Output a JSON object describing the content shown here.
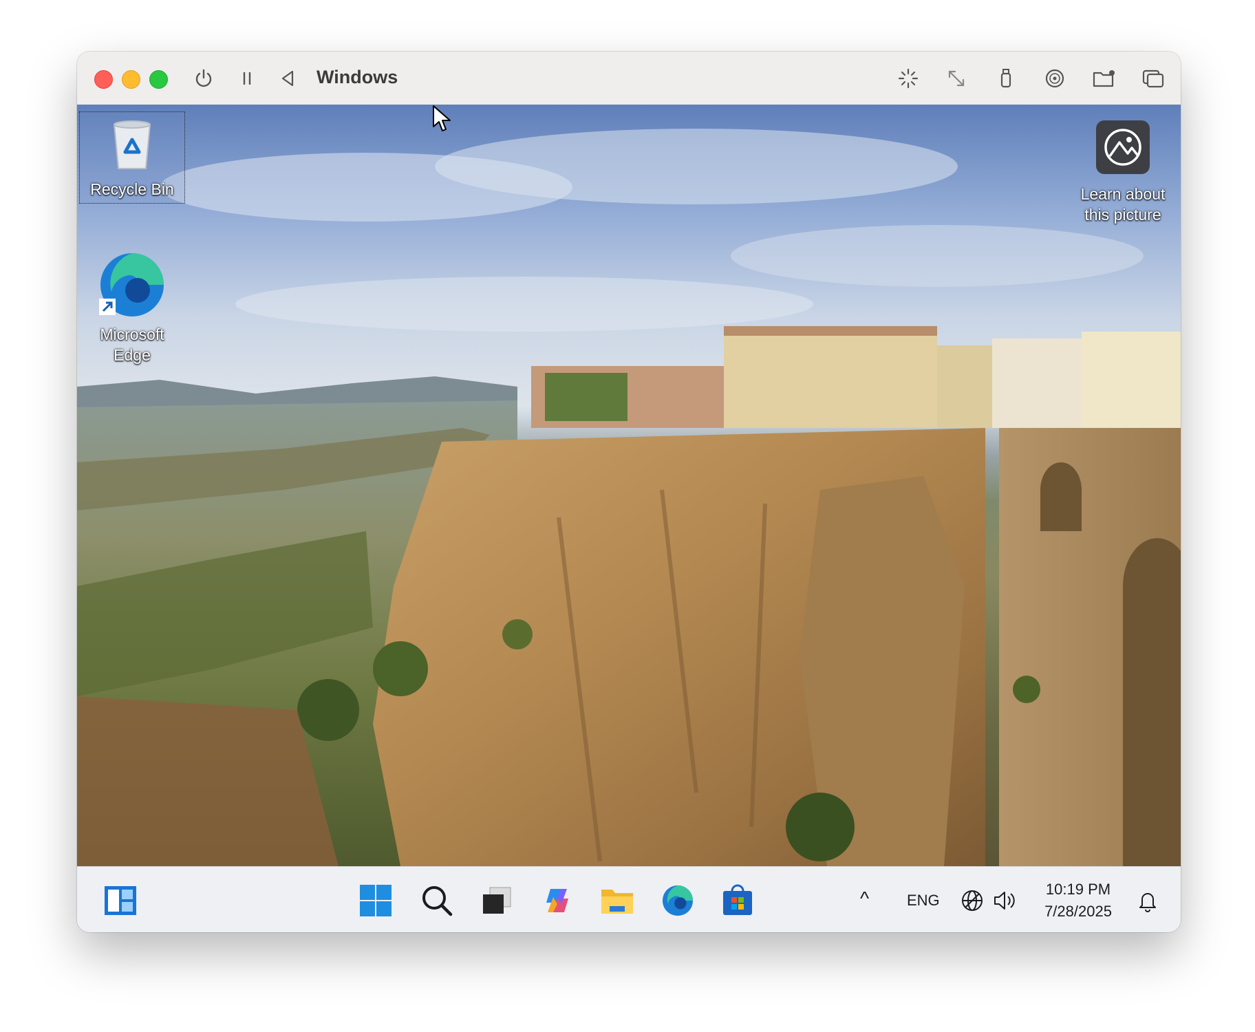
{
  "window": {
    "title": "Windows",
    "controls": [
      "power-icon",
      "pause-icon",
      "back-icon"
    ],
    "toolbar_icons": [
      "brightness-icon",
      "resize-icon",
      "usb-icon",
      "disc-icon",
      "shared-folder-icon",
      "windows-overlap-icon"
    ]
  },
  "desktop": {
    "icons": [
      {
        "label": "Recycle Bin"
      },
      {
        "label_line1": "Microsoft",
        "label_line2": "Edge"
      }
    ],
    "learn_about": {
      "line1": "Learn about",
      "line2": "this picture"
    }
  },
  "taskbar": {
    "apps": [
      "widgets-icon",
      "start-icon",
      "search-icon",
      "task-view-icon",
      "copilot-icon",
      "file-explorer-icon",
      "edge-icon",
      "store-icon"
    ],
    "tray": {
      "chevron": "^",
      "language": "ENG",
      "time": "10:19 PM",
      "date": "7/28/2025"
    }
  },
  "colors": {
    "accent_blue": "#0067c0",
    "traffic_red": "#ff5f57",
    "traffic_yellow": "#febc2e",
    "traffic_green": "#28c840"
  }
}
